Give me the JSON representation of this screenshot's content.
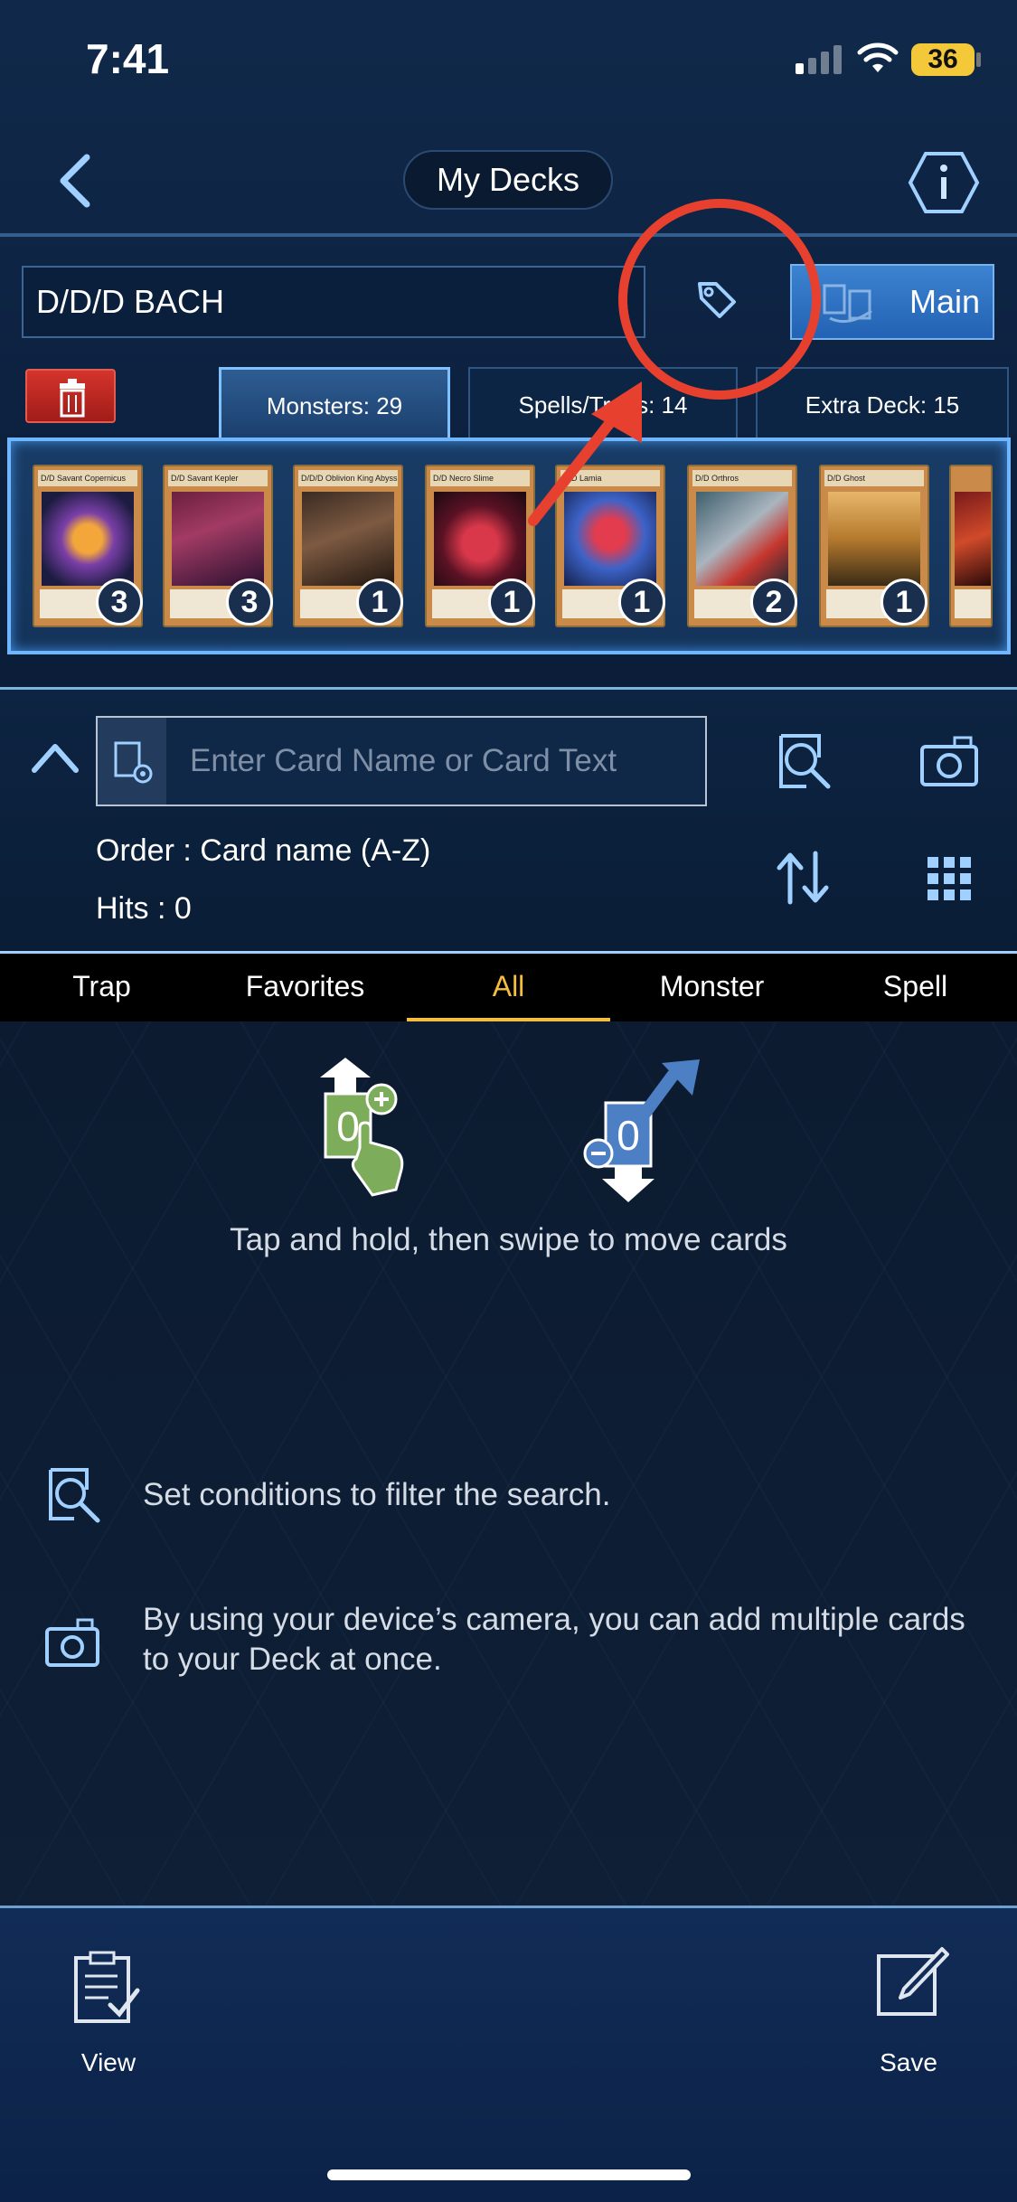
{
  "status_bar": {
    "time": "7:41",
    "battery": "36"
  },
  "header": {
    "title": "My Decks"
  },
  "deck": {
    "name": "D/D/D BACH",
    "main_label": "Main"
  },
  "tabs": [
    {
      "label": "Monsters: 29",
      "active": true
    },
    {
      "label": "Spells/Traps: 14",
      "active": false
    },
    {
      "label": "Extra Deck: 15",
      "active": false
    }
  ],
  "cards": [
    {
      "name": "D/D Savant Copernicus",
      "count": "3"
    },
    {
      "name": "D/D Savant Kepler",
      "count": "3"
    },
    {
      "name": "D/D/D Oblivion King Abyss Ragnarok",
      "count": "1"
    },
    {
      "name": "D/D Necro Slime",
      "count": "1"
    },
    {
      "name": "D/D Lamia",
      "count": "1"
    },
    {
      "name": "D/D Orthros",
      "count": "2"
    },
    {
      "name": "D/D Ghost",
      "count": "1"
    }
  ],
  "search": {
    "placeholder": "Enter Card Name or Card Text",
    "order": "Order : Card name (A-Z)",
    "hits": "Hits : 0"
  },
  "filter_tabs": [
    "Trap",
    "Favorites",
    "All",
    "Monster",
    "Spell"
  ],
  "active_filter": "All",
  "hints": {
    "move": "Tap and hold, then swipe to move cards",
    "filter": "Set conditions to filter the search.",
    "camera": "By using your device’s camera, you can add multiple cards to your Deck at once."
  },
  "bottom": {
    "view_label": "View",
    "save_label": "Save"
  },
  "colors": {
    "accent": "#f4bd3e",
    "annotation": "#e8402e",
    "primary_blue": "#2e6fc0"
  }
}
